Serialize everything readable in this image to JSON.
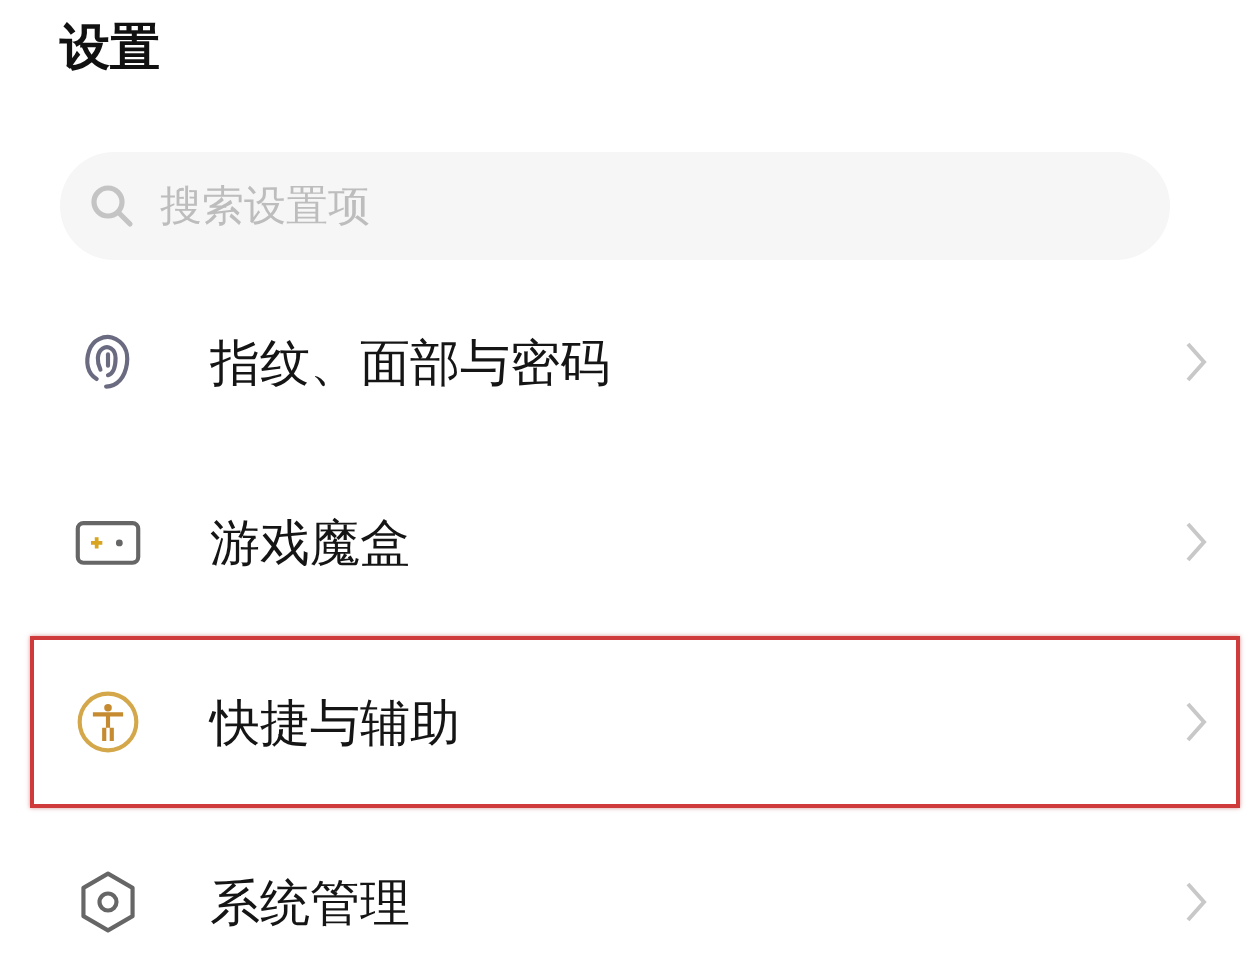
{
  "title": "设置",
  "search": {
    "placeholder": "搜索设置项"
  },
  "items": [
    {
      "kind": "fingerprint",
      "label": "指纹、面部与密码",
      "highlighted": false
    },
    {
      "kind": "gamepad",
      "label": "游戏魔盒",
      "highlighted": false
    },
    {
      "kind": "accessibility",
      "label": "快捷与辅助",
      "highlighted": true
    },
    {
      "kind": "system",
      "label": "系统管理",
      "highlighted": false
    }
  ]
}
